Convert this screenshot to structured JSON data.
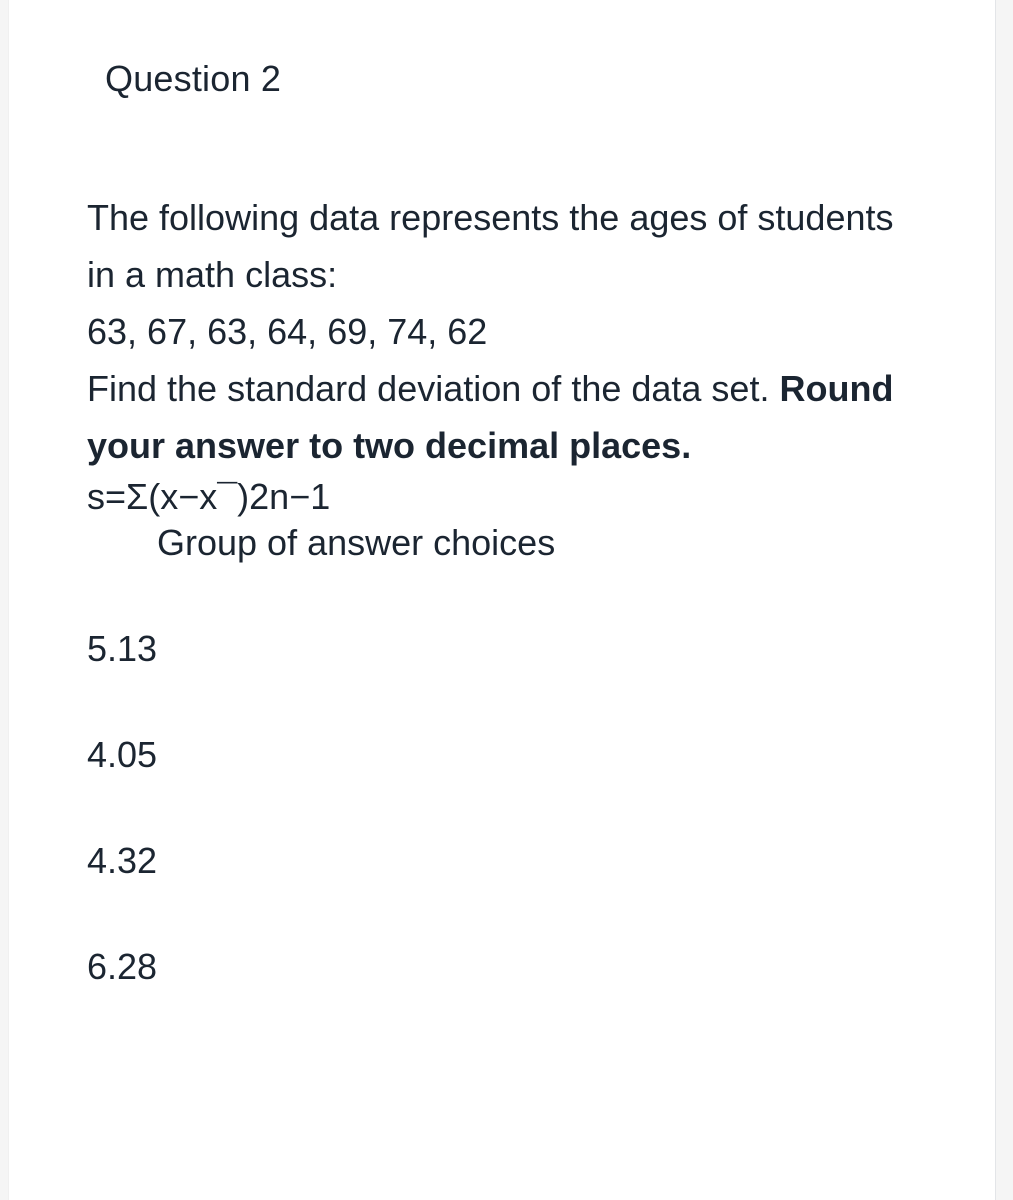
{
  "question": {
    "title": "Question 2",
    "intro": "The following data represents the ages of students in a math class:",
    "data_values": "63,  67,  63,  64,  69,  74,  62",
    "instruction_plain": "Find the standard deviation of the data set. ",
    "instruction_bold": "Round your answer to two decimal places.",
    "formula": "s=Σ(x−x¯)2n−1",
    "choices_label": "Group of answer choices",
    "choices": [
      "5.13",
      "4.05",
      "4.32",
      "6.28"
    ]
  }
}
